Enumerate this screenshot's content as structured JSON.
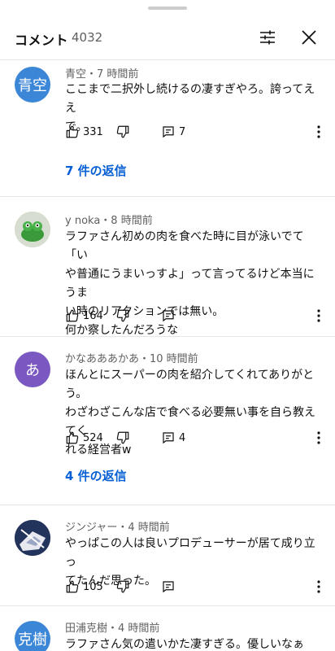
{
  "header": {
    "title": "コメント",
    "count": "4032"
  },
  "comments": [
    {
      "avatar_text": "青空",
      "avatar_color": "#3b86d6",
      "meta": "青空・7 時間前",
      "lines": [
        "ここまで二択外し続けるの凄すぎやろ。誇ってええ",
        "で。"
      ],
      "likes": "331",
      "replies_count": "7",
      "replies_link": "7 件の返信"
    },
    {
      "avatar_text": "",
      "avatar_color": "#cfd8c4",
      "meta": "y noka・8 時間前",
      "lines": [
        "ラファさん初めの肉を食べた時に目が泳いでて「い",
        "や普通にうまいっすよ」って言ってるけど本当にうま",
        "い時のリアクションでは無い。",
        "何か察したんだろうな"
      ],
      "likes": "164",
      "replies_count": "",
      "replies_link": ""
    },
    {
      "avatar_text": "あ",
      "avatar_color": "#7b57c2",
      "meta": "かなあああかあ・10 時間前",
      "lines": [
        "ほんとにスーパーの肉を紹介してくれてありがとう。",
        "わざわざこんな店で食べる必要無い事を自ら教えてく",
        "れる経営者w"
      ],
      "likes": "524",
      "replies_count": "4",
      "replies_link": "4 件の返信"
    },
    {
      "avatar_text": "",
      "avatar_color": "#1c2a4a",
      "meta": "ジンジャー・4 時間前",
      "lines": [
        "やっぱこの人は良いプロデューサーが居て成り立っ",
        "てたんだ思った。"
      ],
      "likes": "105",
      "replies_count": "",
      "replies_link": ""
    },
    {
      "avatar_text": "克樹",
      "avatar_color": "#3b86d6",
      "meta": "田浦克樹・4 時間前",
      "lines": [
        "ラファさん気の遣いかた凄すぎる。優しいなぁ"
      ],
      "likes": "",
      "replies_count": "",
      "replies_link": ""
    }
  ]
}
